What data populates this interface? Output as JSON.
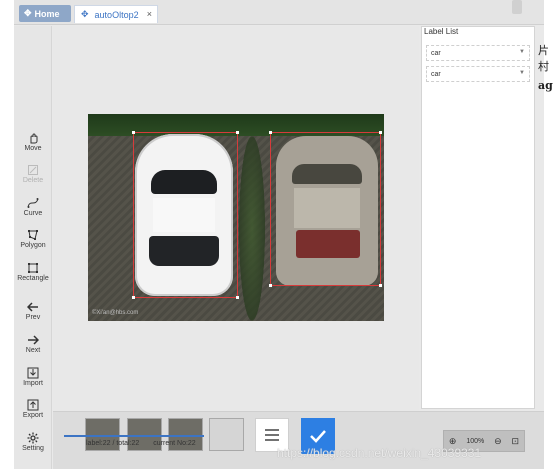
{
  "tabs": {
    "home_label": "Home",
    "file_label": "autoOltop2",
    "close_glyph": "×"
  },
  "toolbar": {
    "items": [
      {
        "label": "Move",
        "icon": "hand-icon"
      },
      {
        "label": "Delete",
        "icon": "delete-icon"
      },
      {
        "label": "Curve",
        "icon": "curve-icon"
      },
      {
        "label": "Polygon",
        "icon": "polygon-icon"
      },
      {
        "label": "Rectangle",
        "icon": "rectangle-icon"
      },
      {
        "label": "Prev",
        "icon": "prev-arrow-icon"
      },
      {
        "label": "Next",
        "icon": "next-arrow-icon"
      },
      {
        "label": "Import",
        "icon": "import-icon"
      },
      {
        "label": "Export",
        "icon": "export-icon"
      },
      {
        "label": "Setting",
        "icon": "gear-icon"
      }
    ]
  },
  "canvas": {
    "image_watermark": "©Xi'an@hbs.com"
  },
  "label_list": {
    "title": "Label List",
    "labels": [
      "car",
      "car"
    ]
  },
  "bottom": {
    "labeled_text": "label:22 / total:22",
    "current_text": "current No:22",
    "progress": 1.0,
    "zoom_text": "100%"
  },
  "overlay": {
    "blog_watermark": "https://blog.csdn.net/weixin_43039331",
    "edge_fragment_1": "片村",
    "edge_fragment_2": "ag"
  },
  "colors": {
    "accent": "#2d7fe3",
    "bbox": "#d63b3b",
    "home_tab": "#8ea7c8"
  }
}
